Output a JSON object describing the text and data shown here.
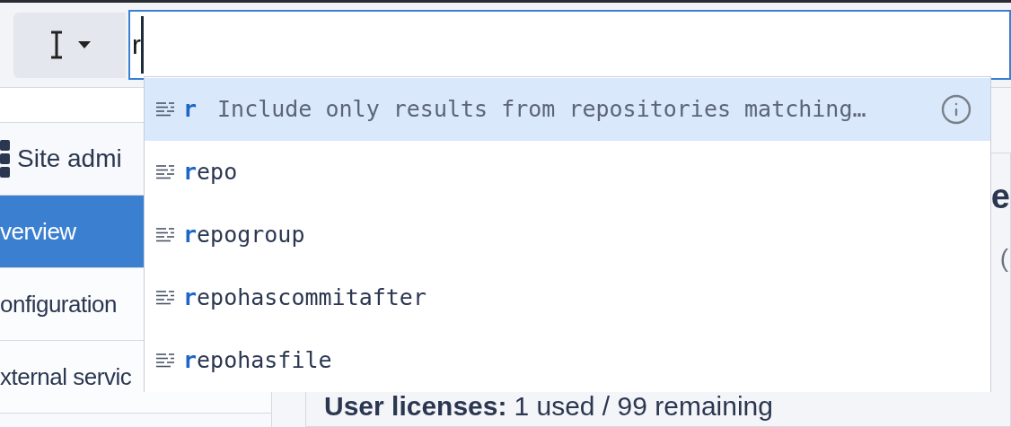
{
  "search": {
    "value": "r"
  },
  "suggestions": [
    {
      "kind": "filter",
      "label": "**r**",
      "description": "Include only results from repositories matching…",
      "selected": true
    },
    {
      "kind": "filter",
      "label": "**r**epo",
      "selected": false
    },
    {
      "kind": "filter",
      "label": "**r**epogroup",
      "selected": false
    },
    {
      "kind": "filter",
      "label": "**r**epohascommitafter",
      "selected": false
    },
    {
      "kind": "filter",
      "label": "**r**epohasfile",
      "selected": false
    }
  ],
  "sidebar": {
    "header": "Site admi",
    "items": [
      {
        "label": "verview",
        "selected": true
      },
      {
        "label": "onfiguration",
        "selected": false
      },
      {
        "label": "xternal servic",
        "selected": false
      }
    ]
  },
  "main": {
    "heading": "e",
    "subtitle": "(",
    "licenses_label": "User licenses:",
    "licenses_value": "1 used / 99 remaining"
  }
}
